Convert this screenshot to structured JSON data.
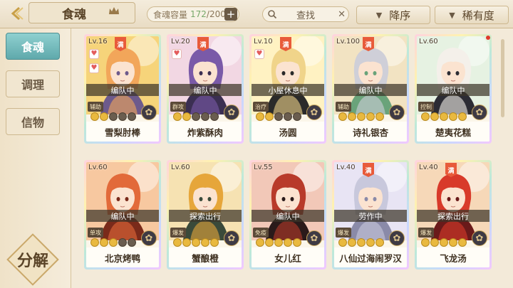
{
  "header": {
    "title": "食魂",
    "capacity_label": "食魂容量",
    "capacity_current": "172",
    "capacity_max": "/200",
    "capacity_add": "+",
    "search_label": "查找",
    "sort_label": "降序",
    "filter_label": "稀有度"
  },
  "sidebar": {
    "tabs": [
      {
        "label": "食魂",
        "active": true
      },
      {
        "label": "调理",
        "active": false
      },
      {
        "label": "信物",
        "active": false
      }
    ],
    "decompose_label": "分解"
  },
  "cards": [
    {
      "level": "Lv.16",
      "max": "满",
      "hearts": 2,
      "status": "编队中",
      "role": "辅助",
      "stars": 5,
      "stars_on": 2,
      "name": "雪梨肘棒",
      "colors": [
        "#f6d47a",
        "#f2a65a",
        "#6d5a8c"
      ]
    },
    {
      "level": "Lv.20",
      "max": "满",
      "hearts": 1,
      "status": "编队中",
      "role": "群攻",
      "stars": 5,
      "stars_on": 2,
      "name": "炸紫酥肉",
      "colors": [
        "#f2d7e3",
        "#7a5aa8",
        "#3b2f52"
      ]
    },
    {
      "level": "Lv.10",
      "max": "满",
      "hearts": 1,
      "status": "小屋休息中",
      "role": "治疗",
      "stars": 5,
      "stars_on": 2,
      "name": "汤圆",
      "colors": [
        "#fff2c2",
        "#f0d48a",
        "#2a2a2a"
      ]
    },
    {
      "level": "Lv.100",
      "max": "满",
      "hearts": 0,
      "status": "编队中",
      "role": "辅助",
      "stars": 5,
      "stars_on": 5,
      "name": "诗礼银杏",
      "colors": [
        "#f2e3c2",
        "#cfcfd8",
        "#6aa37a"
      ]
    },
    {
      "level": "Lv.60",
      "max": "",
      "hearts": 0,
      "status": "编队中",
      "role": "控制",
      "stars": 5,
      "stars_on": 5,
      "name": "楚夷花糕",
      "colors": [
        "#e6f2e2",
        "#f4f0ea",
        "#2c2c34"
      ]
    },
    {
      "level": "Lv.60",
      "max": "",
      "hearts": 0,
      "status": "编队中",
      "role": "单攻",
      "stars": 5,
      "stars_on": 3,
      "name": "北京烤鸭",
      "colors": [
        "#f7c8a0",
        "#e26a3a",
        "#7a2a1a"
      ]
    },
    {
      "level": "Lv.60",
      "max": "",
      "hearts": 0,
      "status": "探索出行",
      "role": "爆发",
      "stars": 5,
      "stars_on": 5,
      "name": "蟹酿橙",
      "colors": [
        "#f6e2b2",
        "#e6a63a",
        "#3a4a3a"
      ]
    },
    {
      "level": "Lv.55",
      "max": "",
      "hearts": 0,
      "status": "编队中",
      "role": "免疫",
      "stars": 5,
      "stars_on": 5,
      "name": "女儿红",
      "colors": [
        "#f2c8b8",
        "#b83a2a",
        "#2a1a1a"
      ]
    },
    {
      "level": "Lv.40",
      "max": "满",
      "hearts": 0,
      "status": "劳作中",
      "role": "爆发",
      "stars": 5,
      "stars_on": 5,
      "name": "八仙过海闹罗汉",
      "colors": [
        "#e8e4f4",
        "#c8c8dc",
        "#8a8aa8"
      ]
    },
    {
      "level": "Lv.40",
      "max": "满",
      "hearts": 0,
      "status": "探索出行",
      "role": "爆发",
      "stars": 5,
      "stars_on": 5,
      "name": "飞龙汤",
      "colors": [
        "#f6d8b8",
        "#d83a2a",
        "#6a1a1a"
      ]
    }
  ]
}
